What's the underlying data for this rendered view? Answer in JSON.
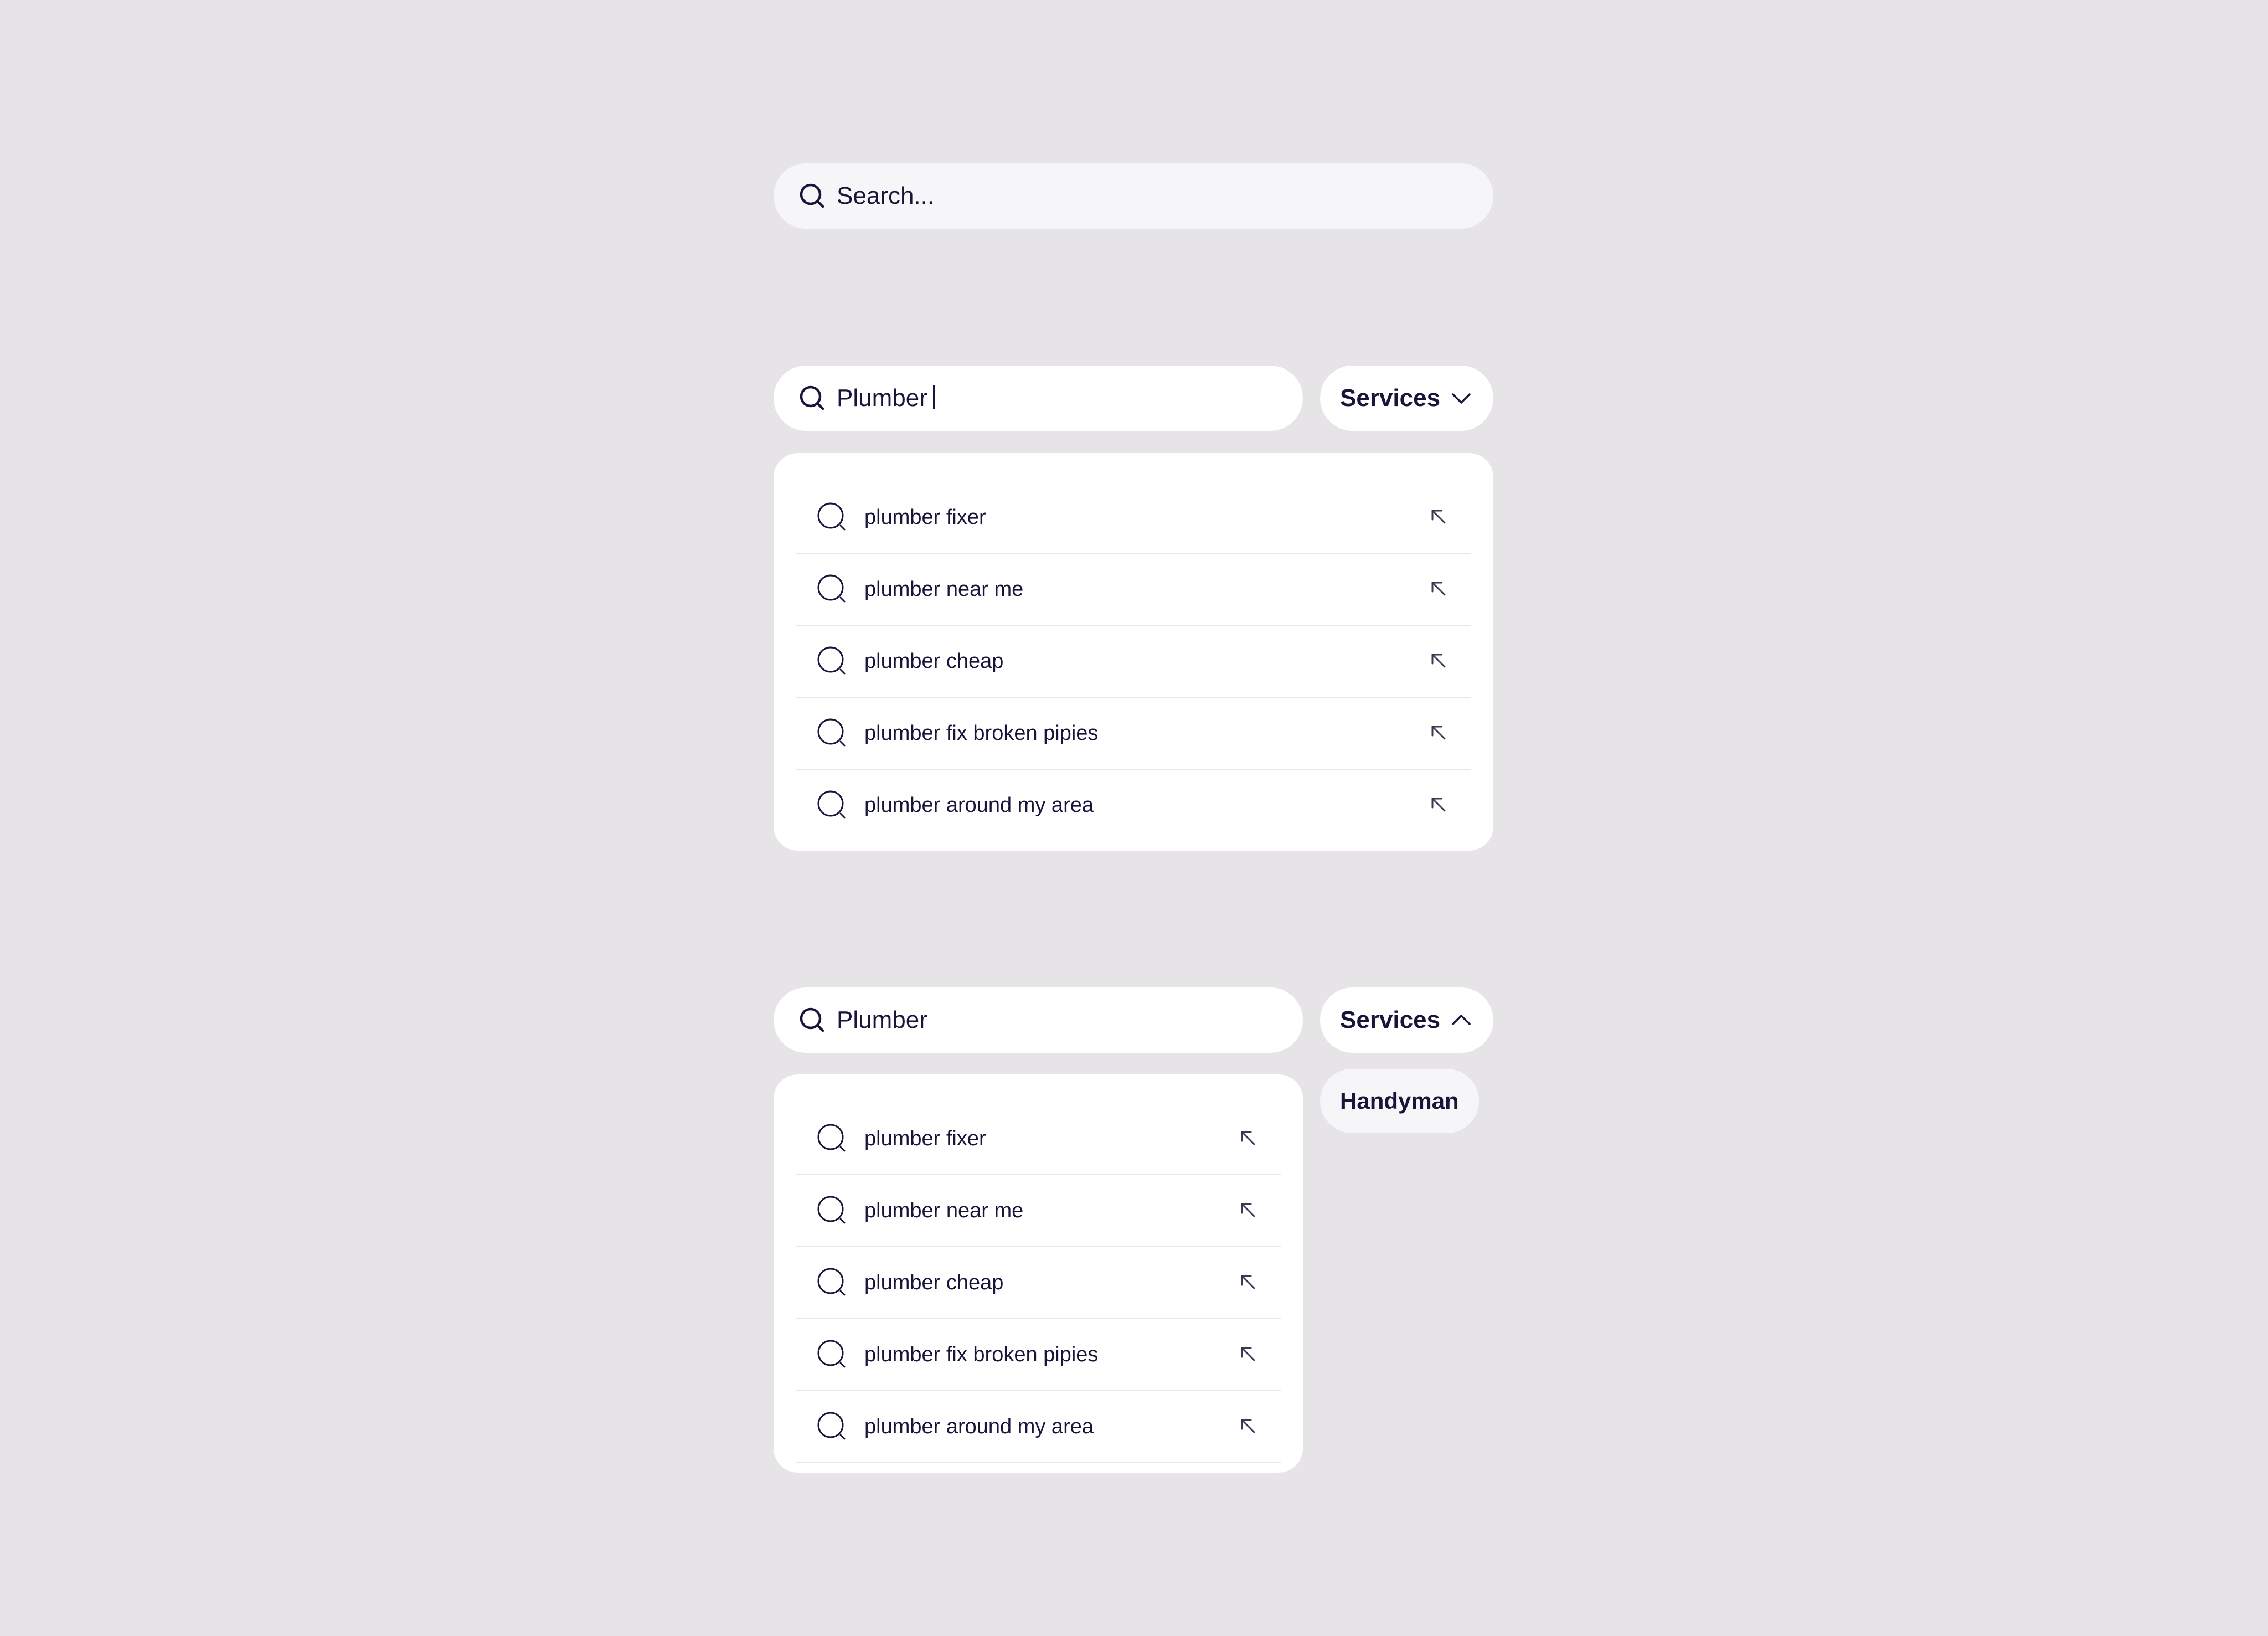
{
  "colors": {
    "background": "#e6e4e7",
    "text": "#17163a",
    "field_idle": "#f6f5f8",
    "field_active": "#ffffff",
    "divider": "#e8e7ec"
  },
  "search_idle": {
    "placeholder": "Search...",
    "icon": "search-icon"
  },
  "search_typing": {
    "value": "Plumber",
    "icon": "search-icon",
    "services_label": "Services",
    "services_icon": "chevron-down-icon",
    "suggestions": [
      {
        "text": "plumber fixer",
        "icon": "search-icon",
        "action_icon": "arrow-up-left-icon"
      },
      {
        "text": "plumber near me",
        "icon": "search-icon",
        "action_icon": "arrow-up-left-icon"
      },
      {
        "text": "plumber cheap",
        "icon": "search-icon",
        "action_icon": "arrow-up-left-icon"
      },
      {
        "text": "plumber fix broken pipies",
        "icon": "search-icon",
        "action_icon": "arrow-up-left-icon"
      },
      {
        "text": "plumber around my area",
        "icon": "search-icon",
        "action_icon": "arrow-up-left-icon"
      }
    ]
  },
  "search_filtered": {
    "value": "Plumber",
    "icon": "search-icon",
    "services_label": "Services",
    "services_icon": "chevron-up-icon",
    "options": [
      {
        "label": "Handyman"
      }
    ],
    "suggestions": [
      {
        "text": "plumber fixer",
        "icon": "search-icon",
        "action_icon": "arrow-up-left-icon"
      },
      {
        "text": "plumber near me",
        "icon": "search-icon",
        "action_icon": "arrow-up-left-icon"
      },
      {
        "text": "plumber cheap",
        "icon": "search-icon",
        "action_icon": "arrow-up-left-icon"
      },
      {
        "text": "plumber fix broken pipies",
        "icon": "search-icon",
        "action_icon": "arrow-up-left-icon"
      },
      {
        "text": "plumber around my area",
        "icon": "search-icon",
        "action_icon": "arrow-up-left-icon"
      }
    ]
  }
}
